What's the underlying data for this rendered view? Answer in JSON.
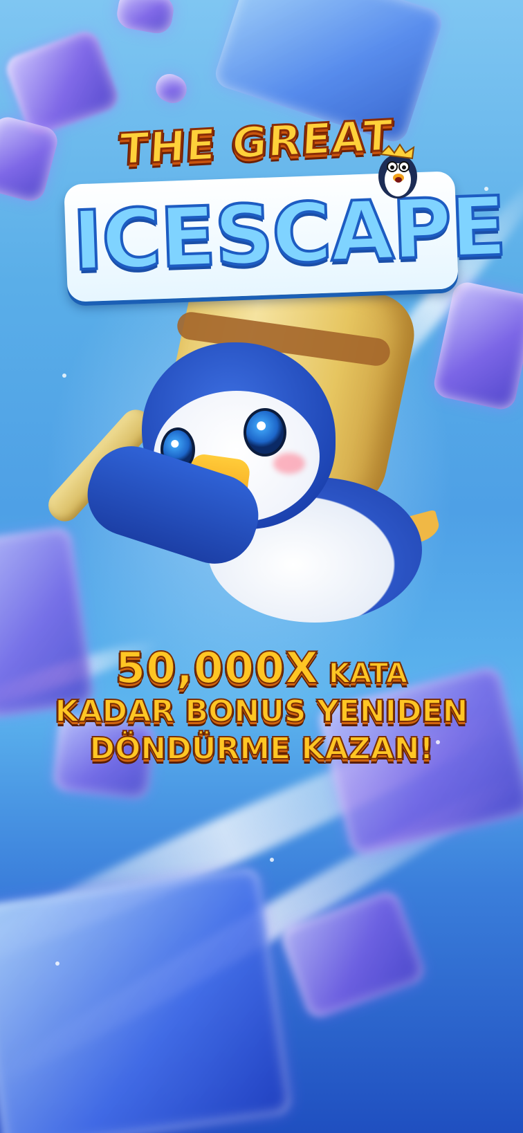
{
  "game": {
    "logo": {
      "line1": "THE GREAT",
      "line2": "ICESCAPE"
    },
    "promo": {
      "multiplier": "50,000X",
      "line1_suffix": "KATA",
      "line2": "KADAR BONUS YENIDEN",
      "line3": "DÖNDÜRME KAZAN!"
    }
  },
  "colors": {
    "sky_top": "#7fc6f2",
    "sky_bottom": "#1f4fc0",
    "title_gold": "#ffc624",
    "title_outline": "#7a2e05",
    "logo_ice": "#7fd3ff",
    "ice_cube_purple": "#8a5ae6"
  },
  "icons": {
    "mascot": "penguin-with-mallet-illustration",
    "logo_mascot": "small-penguin-icon"
  }
}
